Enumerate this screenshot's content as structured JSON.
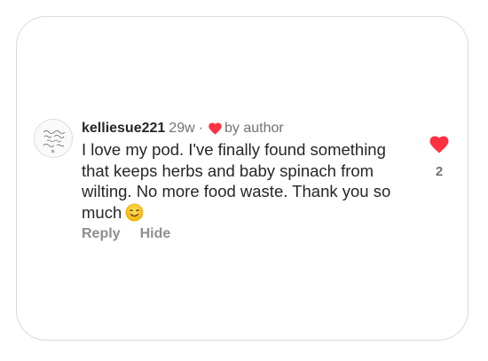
{
  "comment": {
    "username": "kelliesue221",
    "age": "29w",
    "separator": "·",
    "liked_by_label": "by author",
    "text": "I love my pod. I've finally found something that keeps herbs and baby spinach from wilting. No more food waste. Thank you so much",
    "emoji": "smiling-face-emoji",
    "like_count": "2",
    "actions": {
      "reply_label": "Reply",
      "hide_label": "Hide"
    }
  },
  "colors": {
    "heart": "#ff3040",
    "primary_text": "#262626",
    "secondary_text": "#737373",
    "action_text": "#8e8e8e",
    "card_border": "#d9d9d9"
  },
  "icons": {
    "author_like": "heart-icon",
    "like_button": "heart-filled-icon"
  }
}
